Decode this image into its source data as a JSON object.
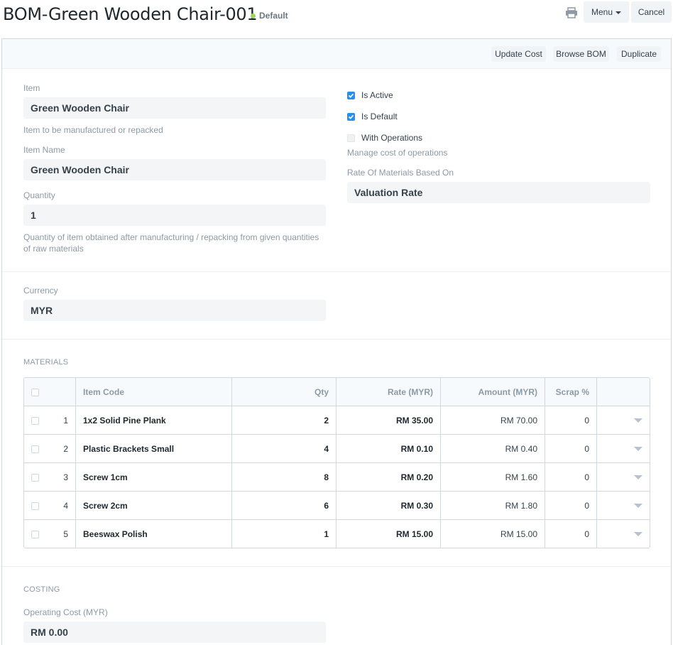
{
  "header": {
    "title": "BOM-Green Wooden Chair-001",
    "status": "Default",
    "status_color": "#98d85b",
    "menu_label": "Menu",
    "cancel_label": "Cancel",
    "print_icon": "printer-icon"
  },
  "toolbar": {
    "update_cost": "Update Cost",
    "browse_bom": "Browse BOM",
    "duplicate": "Duplicate"
  },
  "form": {
    "item_label": "Item",
    "item_value": "Green Wooden Chair",
    "item_help": "Item to be manufactured or repacked",
    "item_name_label": "Item Name",
    "item_name_value": "Green Wooden Chair",
    "quantity_label": "Quantity",
    "quantity_value": "1",
    "quantity_help_1": "Quantity of item obtained after manufacturing / repacking from given quantities",
    "quantity_help_2": "of raw materials",
    "is_active_label": "Is Active",
    "is_active": true,
    "is_default_label": "Is Default",
    "is_default": true,
    "with_operations_label": "With Operations",
    "with_operations": false,
    "with_operations_help": "Manage cost of operations",
    "rate_basis_label": "Rate Of Materials Based On",
    "rate_basis_value": "Valuation Rate",
    "currency_label": "Currency",
    "currency_value": "MYR"
  },
  "materials": {
    "section_title": "MATERIALS",
    "columns": [
      "Item Code",
      "Qty",
      "Rate (MYR)",
      "Amount (MYR)",
      "Scrap %"
    ],
    "rows": [
      {
        "idx": "1",
        "item_code": "1x2 Solid Pine Plank",
        "qty": "2",
        "rate": "RM 35.00",
        "amount": "RM 70.00",
        "scrap": "0"
      },
      {
        "idx": "2",
        "item_code": "Plastic Brackets Small",
        "qty": "4",
        "rate": "RM 0.10",
        "amount": "RM 0.40",
        "scrap": "0"
      },
      {
        "idx": "3",
        "item_code": "Screw 1cm",
        "qty": "8",
        "rate": "RM 0.20",
        "amount": "RM 1.60",
        "scrap": "0"
      },
      {
        "idx": "4",
        "item_code": "Screw 2cm",
        "qty": "6",
        "rate": "RM 0.30",
        "amount": "RM 1.80",
        "scrap": "0"
      },
      {
        "idx": "5",
        "item_code": "Beeswax Polish",
        "qty": "1",
        "rate": "RM 15.00",
        "amount": "RM 15.00",
        "scrap": "0"
      }
    ]
  },
  "costing": {
    "section_title": "COSTING",
    "operating_cost_label": "Operating Cost (MYR)",
    "operating_cost_value": "RM 0.00"
  }
}
